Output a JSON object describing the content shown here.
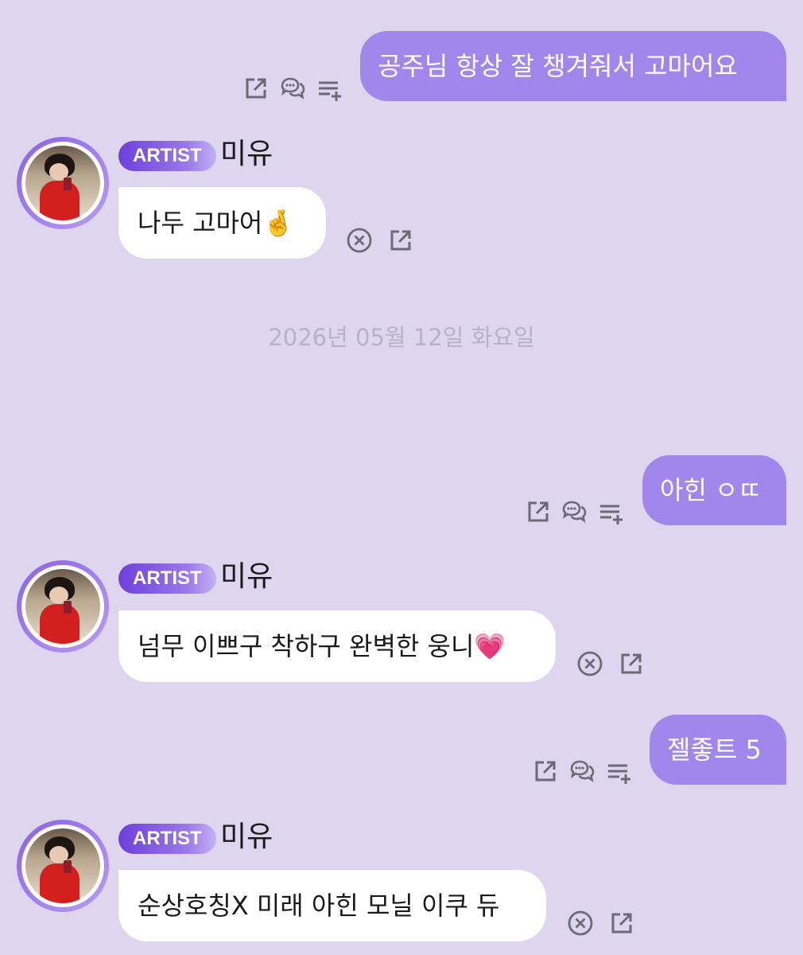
{
  "colors": {
    "background": "#ddd6ee",
    "outgoing_bubble": "#a187ec",
    "incoming_bubble": "#ffffff",
    "icon": "#6b6b75"
  },
  "date_separator": "2026년 05월 12일 화요일",
  "artist": {
    "badge": "ARTIST",
    "name": "미유"
  },
  "messages": [
    {
      "side": "out",
      "text": "공주님 항상 잘 챙겨줘서 고마어요",
      "icons": [
        "share-icon",
        "comment-icon",
        "add-to-list-icon"
      ]
    },
    {
      "side": "in",
      "text": "나두 고마어",
      "emoji": "🤞",
      "icons": [
        "close-circle-icon",
        "share-icon"
      ]
    },
    {
      "side": "out",
      "text": "아힌 ㅇㄸ",
      "icons": [
        "share-icon",
        "comment-icon",
        "add-to-list-icon"
      ]
    },
    {
      "side": "in",
      "text": "넘무 이쁘구 착하구 완벽한 웅니",
      "emoji": "💗",
      "icons": [
        "close-circle-icon",
        "share-icon"
      ]
    },
    {
      "side": "out",
      "text": "젤좋트 5",
      "icons": [
        "share-icon",
        "comment-icon",
        "add-to-list-icon"
      ]
    },
    {
      "side": "in",
      "text": "순상호칭X 미래 아힌 모닐 이쿠 듀",
      "icons": [
        "close-circle-icon",
        "share-icon"
      ]
    }
  ]
}
